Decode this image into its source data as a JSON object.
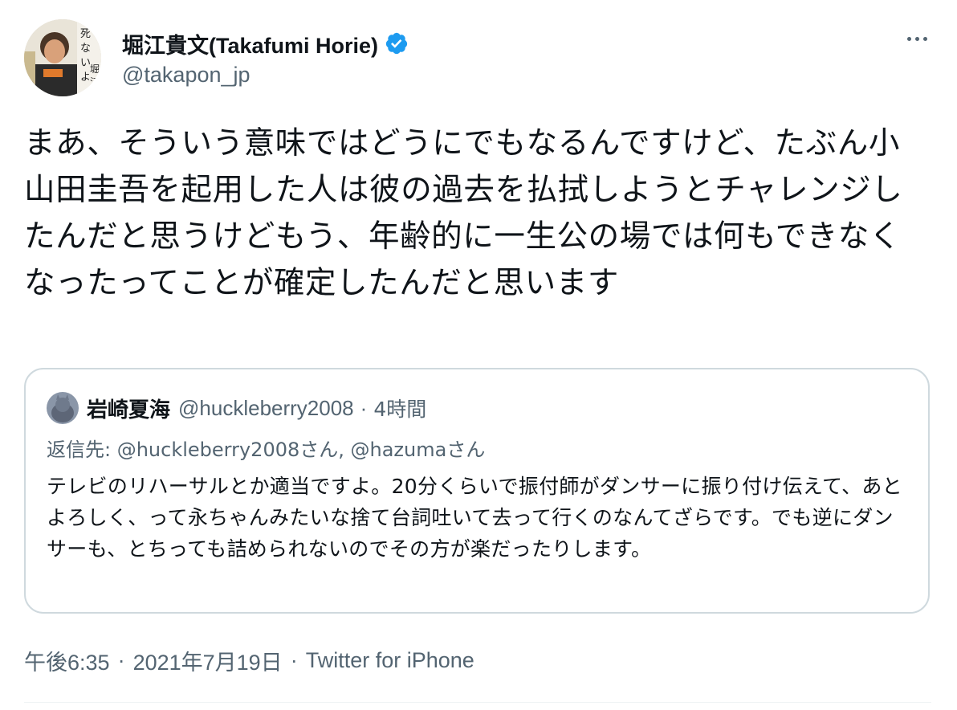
{
  "author": {
    "display_name": "堀江貴文(Takafumi Horie)",
    "handle": "@takapon_jp",
    "verified": true,
    "avatar_icon": "book-cover-avatar",
    "avatar_text": "死なないように稼ぐ。堀江貴文"
  },
  "tweet": {
    "text": "まあ、そういう意味ではどうにでもなるんですけど、たぶん小山田圭吾を起用した人は彼の過去を払拭しようとチャレンジしたんだと思うけどもう、年齢的に一生公の場では何もできなくなったってことが確定したんだと思います"
  },
  "quoted": {
    "name": "岩崎夏海",
    "handle": "@huckleberry2008",
    "separator": "·",
    "time": "4時間",
    "reply_prefix": "返信先: ",
    "reply_to": "@huckleberry2008さん, @hazumaさん",
    "text": "テレビのリハーサルとか適当ですよ。20分くらいで振付師がダンサーに振り付け伝えて、あとよろしく、って永ちゃんみたいな捨て台詞吐いて去って行くのなんてざらです。でも逆にダンサーも、とちっても詰められないのでその方が楽だったりします。"
  },
  "meta": {
    "time": "午後6:35",
    "separator": "·",
    "date": "2021年7月19日",
    "source": "Twitter for iPhone"
  },
  "colors": {
    "text": "#0f1419",
    "secondary": "#536471",
    "verified": "#1d9bf0",
    "border": "#cfd9de"
  }
}
